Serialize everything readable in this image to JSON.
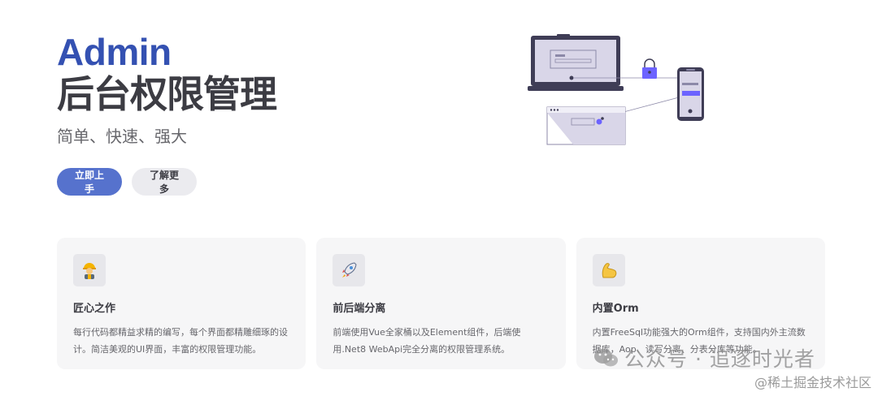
{
  "hero": {
    "name": "Admin",
    "text": "后台权限管理",
    "tagline": "简单、快速、强大"
  },
  "actions": {
    "primary_label": "立即上手",
    "secondary_label": "了解更多"
  },
  "features": [
    {
      "icon": "construction-worker-icon",
      "title": "匠心之作",
      "details": "每行代码都精益求精的编写，每个界面都精雕细琢的设计。简洁美观的UI界面，丰富的权限管理功能。"
    },
    {
      "icon": "rocket-icon",
      "title": "前后端分离",
      "details": "前端使用Vue全家桶以及Element组件，后端使用.Net8 WebApi完全分离的权限管理系统。"
    },
    {
      "icon": "flexed-biceps-icon",
      "title": "内置Orm",
      "details": "内置FreeSql功能强大的Orm组件，支持国内外主流数据库，Aop、读写分离、分表分库等功能。"
    }
  ],
  "watermark": {
    "channel": "公众号 · 追逐时光者",
    "site": "@稀土掘金技术社区"
  },
  "colors": {
    "brand": "#3451b2",
    "button_brand": "#5672cd",
    "illustration_accent": "#6c63ff"
  }
}
